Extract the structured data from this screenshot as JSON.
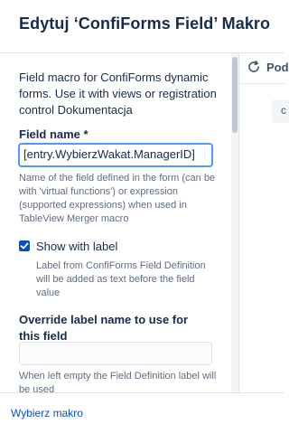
{
  "dialog": {
    "title": "Edytuj ‘ConfiForms Field’ Makro"
  },
  "form": {
    "description": "Field macro for ConfiForms dynamic forms. Use it with views or registration control Dokumentacja",
    "field_name": {
      "label": "Field name *",
      "value": "[entry.WybierzWakat.ManagerID]",
      "help": "Name of the field defined in the form (can be with 'virtual functions') or expression (supported expressions) when used in TableView Merger macro"
    },
    "show_with_label": {
      "label": "Show with label",
      "checked": true,
      "help": "Label from ConfiForms Field Definition will be added as text before the field value"
    },
    "override_label": {
      "label": "Override label name to use for this field",
      "value": "",
      "help": "When left empty the Field Definition label will be used"
    }
  },
  "preview": {
    "header_label": "Pod",
    "icon": "refresh-icon",
    "chip_text": "c"
  },
  "footer": {
    "link": "Wybierz makro"
  },
  "colors": {
    "accent": "#0052cc",
    "focus_ring": "#4c9aff",
    "help_text": "#5e6c84"
  }
}
